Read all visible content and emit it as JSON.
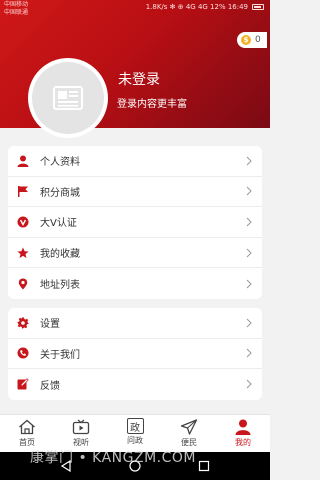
{
  "status_bar": {
    "carrier_1": "中国移动",
    "carrier_2": "中国联通",
    "right_text": "1.8K/s ✻ ⊕ 4G 4G 12% 16:49"
  },
  "points": {
    "count": "0",
    "coin_glyph": "$"
  },
  "profile": {
    "name": "未登录",
    "subtitle": "登录内容更丰富"
  },
  "menu_group_1": [
    {
      "label": "个人资料",
      "icon": "person-icon"
    },
    {
      "label": "积分商城",
      "icon": "flag-icon"
    },
    {
      "label": "大V认证",
      "icon": "verified-v-icon"
    },
    {
      "label": "我的收藏",
      "icon": "star-icon"
    },
    {
      "label": "地址列表",
      "icon": "location-pin-icon"
    }
  ],
  "menu_group_2": [
    {
      "label": "设置",
      "icon": "gear-icon"
    },
    {
      "label": "关于我们",
      "icon": "phone-icon"
    },
    {
      "label": "反馈",
      "icon": "edit-icon"
    }
  ],
  "tabs": [
    {
      "label": "首页",
      "icon": "home-icon"
    },
    {
      "label": "视听",
      "icon": "tv-icon"
    },
    {
      "label": "问政",
      "icon": "zheng-icon",
      "glyph": "政"
    },
    {
      "label": "便民",
      "icon": "send-icon"
    },
    {
      "label": "我的",
      "icon": "user-icon",
      "active": true
    }
  ],
  "colors": {
    "accent": "#c8161d",
    "header_start": "#d01818",
    "header_end": "#7a0a14",
    "coin": "#f3b22a"
  },
  "watermark": "康掌门 • KANGZM.COM"
}
